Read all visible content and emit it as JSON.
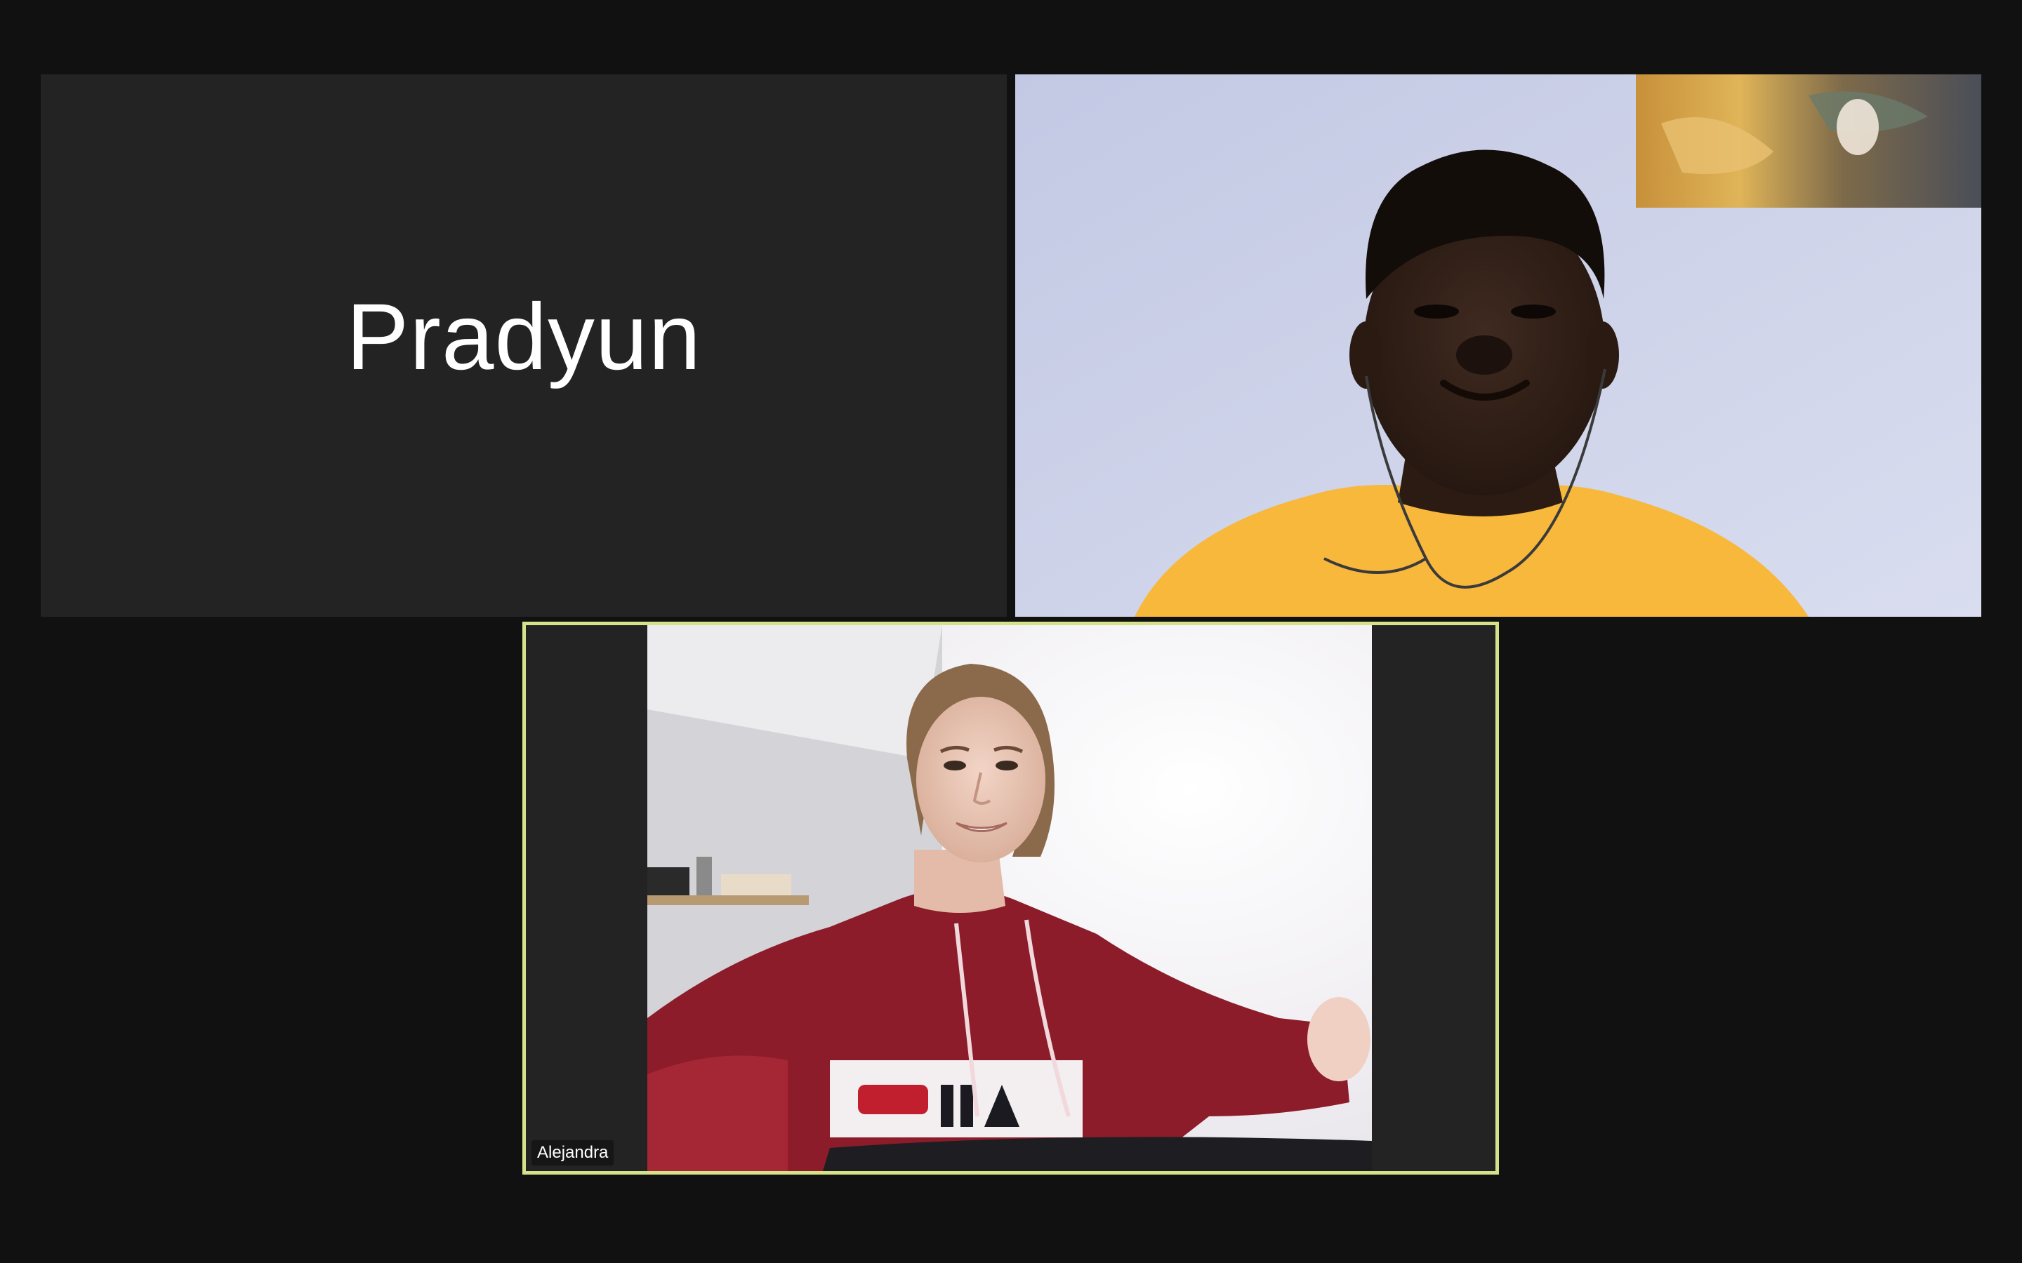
{
  "meeting": {
    "layout": "gallery-view",
    "background_color": "#111111",
    "active_speaker_border_color": "#d6e28a"
  },
  "participants": [
    {
      "name": "Pradyun",
      "video": "off",
      "display": "name-only"
    },
    {
      "name": "",
      "video": "on",
      "display": "video"
    },
    {
      "name": "Alejandra",
      "video": "on",
      "display": "video",
      "active_speaker": true
    }
  ]
}
